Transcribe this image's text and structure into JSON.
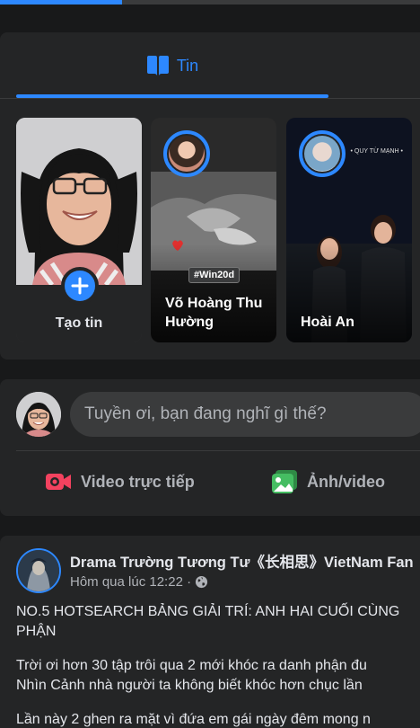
{
  "top_bar": {
    "progress": 0.29
  },
  "stories": {
    "tab_label": "Tin",
    "create_label": "Tạo tin",
    "items": [
      {
        "name": "Võ Hoàng Thu Hường",
        "tag": "#Win20d"
      },
      {
        "name": "Hoài An",
        "watermark": "• QUY TỪ MẠNH •"
      }
    ]
  },
  "composer": {
    "placeholder": "Tuyền ơi, bạn đang nghĩ gì thế?",
    "live_label": "Video trực tiếp",
    "photo_label": "Ảnh/video"
  },
  "post": {
    "page_name": "Drama Trường Tương Tư《长相思》VietNam Fan",
    "time": "Hôm qua lúc 12:22 ·",
    "lines": [
      "NO.5 HOTSEARCH BẢNG GIẢI TRÍ: ANH HAI CUỐI CÙNG",
      "PHẬN",
      "Trời ơi hơn 30 tập trôi qua 2 mới khóc ra danh phận đu",
      "Nhìn Cảnh nhà người ta không biết khóc hơn chục lần",
      "Lần này 2 ghen ra mặt vì đứa em gái ngày đêm mong n"
    ]
  },
  "colors": {
    "accent": "#2d88ff",
    "live_red": "#f3425f",
    "photo_green": "#45bd62",
    "card": "#242526",
    "page_bg": "#18191a"
  },
  "icons": [
    "book-open-icon",
    "plus-icon",
    "live-video-icon",
    "photo-icon",
    "globe-icon"
  ]
}
